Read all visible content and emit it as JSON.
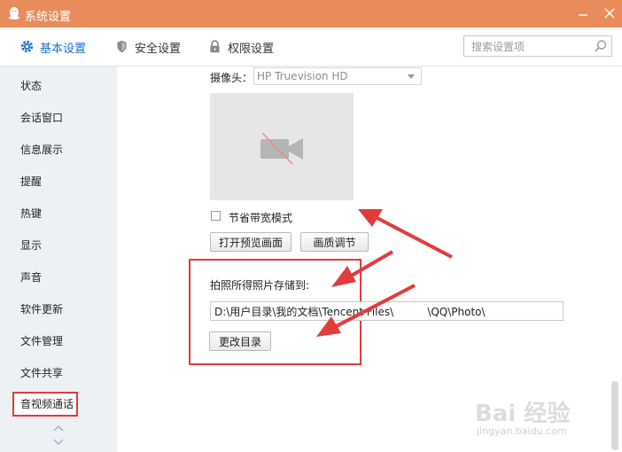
{
  "window": {
    "title": "系统设置",
    "accent_color": "#e88c5c"
  },
  "tabs": [
    {
      "label": "基本设置",
      "icon": "gear-icon",
      "active": true
    },
    {
      "label": "安全设置",
      "icon": "shield-icon",
      "active": false
    },
    {
      "label": "权限设置",
      "icon": "lock-icon",
      "active": false
    }
  ],
  "search": {
    "placeholder": "搜索设置项",
    "value": ""
  },
  "sidebar": {
    "items": [
      {
        "label": "状态"
      },
      {
        "label": "会话窗口"
      },
      {
        "label": "信息展示"
      },
      {
        "label": "提醒"
      },
      {
        "label": "热键"
      },
      {
        "label": "显示"
      },
      {
        "label": "声音"
      },
      {
        "label": "软件更新"
      },
      {
        "label": "文件管理"
      },
      {
        "label": "文件共享"
      },
      {
        "label": "音视频通话",
        "active": true
      }
    ]
  },
  "camera": {
    "label": "摄像头：",
    "selected": "HP Truevision HD"
  },
  "bandwidth": {
    "label": "节省带宽模式",
    "checked": false
  },
  "buttons": {
    "open_preview": "打开预览画面",
    "quality": "画质调节",
    "change_dir": "更改目录"
  },
  "photo": {
    "label": "拍照所得照片存储到:",
    "path": "D:\\用户目录\\我的文档\\Tencent Files\\          \\QQ\\Photo\\"
  },
  "watermark": {
    "main": "Bai 经验",
    "sub": "jingyan.baidu.com"
  }
}
